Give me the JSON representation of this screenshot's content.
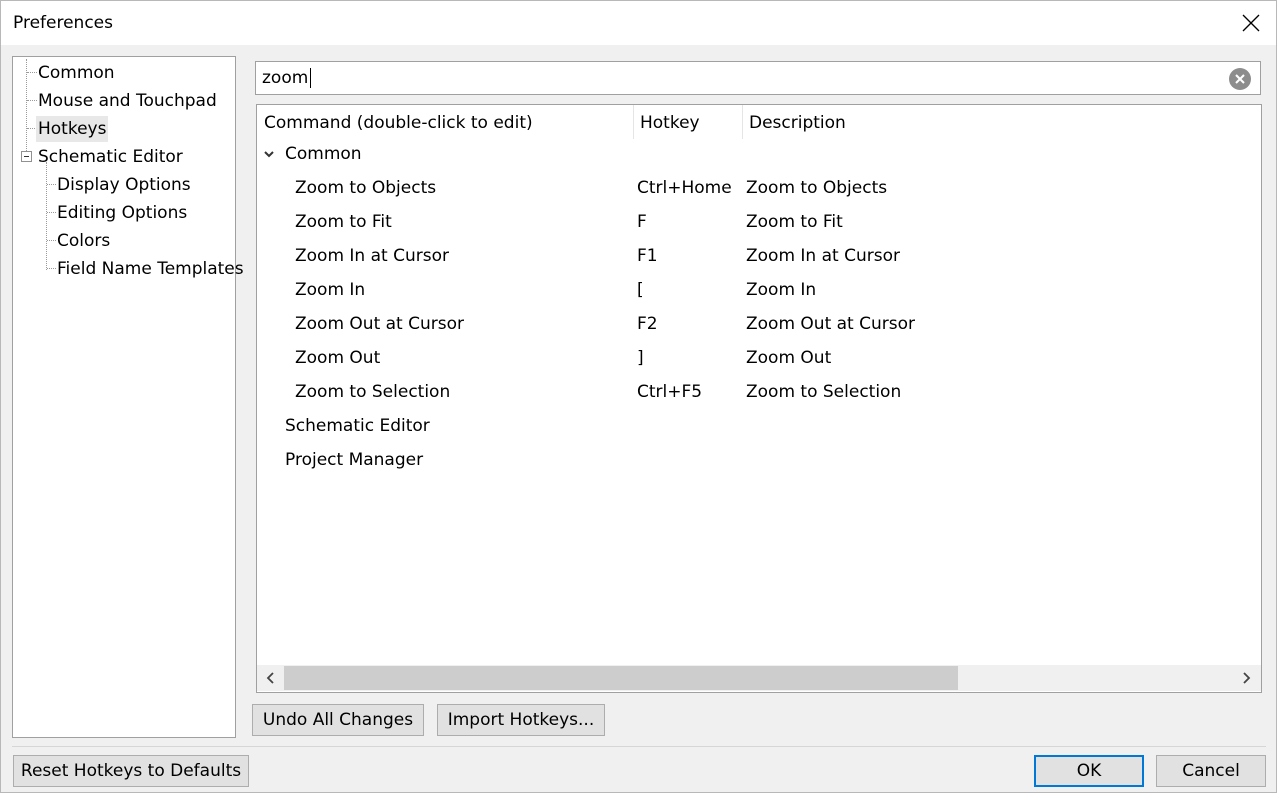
{
  "window": {
    "title": "Preferences"
  },
  "tree": {
    "items": [
      {
        "label": "Common"
      },
      {
        "label": "Mouse and Touchpad"
      },
      {
        "label": "Hotkeys",
        "selected": true
      },
      {
        "label": "Schematic Editor",
        "expanded": true
      },
      {
        "label": "Display Options"
      },
      {
        "label": "Editing Options"
      },
      {
        "label": "Colors"
      },
      {
        "label": "Field Name Templates"
      }
    ]
  },
  "search": {
    "value": "zoom",
    "placeholder": ""
  },
  "table": {
    "columns": [
      "Command (double-click to edit)",
      "Hotkey",
      "Description"
    ],
    "groups": [
      {
        "name": "Common",
        "expanded": true,
        "rows": [
          {
            "command": "Zoom to Objects",
            "hotkey": "Ctrl+Home",
            "description": "Zoom to Objects"
          },
          {
            "command": "Zoom to Fit",
            "hotkey": "F",
            "description": "Zoom to Fit"
          },
          {
            "command": "Zoom In at Cursor",
            "hotkey": "F1",
            "description": "Zoom In at Cursor"
          },
          {
            "command": "Zoom In",
            "hotkey": "[",
            "description": "Zoom In"
          },
          {
            "command": "Zoom Out at Cursor",
            "hotkey": "F2",
            "description": "Zoom Out at Cursor"
          },
          {
            "command": "Zoom Out",
            "hotkey": "]",
            "description": "Zoom Out"
          },
          {
            "command": "Zoom to Selection",
            "hotkey": "Ctrl+F5",
            "description": "Zoom to Selection"
          }
        ]
      },
      {
        "name": "Schematic Editor",
        "expanded": false,
        "rows": []
      },
      {
        "name": "Project Manager",
        "expanded": false,
        "rows": []
      }
    ]
  },
  "buttons": {
    "undo_all": "Undo All Changes",
    "import_hotkeys": "Import Hotkeys...",
    "reset_defaults": "Reset Hotkeys to Defaults",
    "ok": "OK",
    "cancel": "Cancel"
  },
  "colors": {
    "accent": "#0078d7",
    "selection": "#e8e8e8",
    "background": "#f0f0f0"
  }
}
